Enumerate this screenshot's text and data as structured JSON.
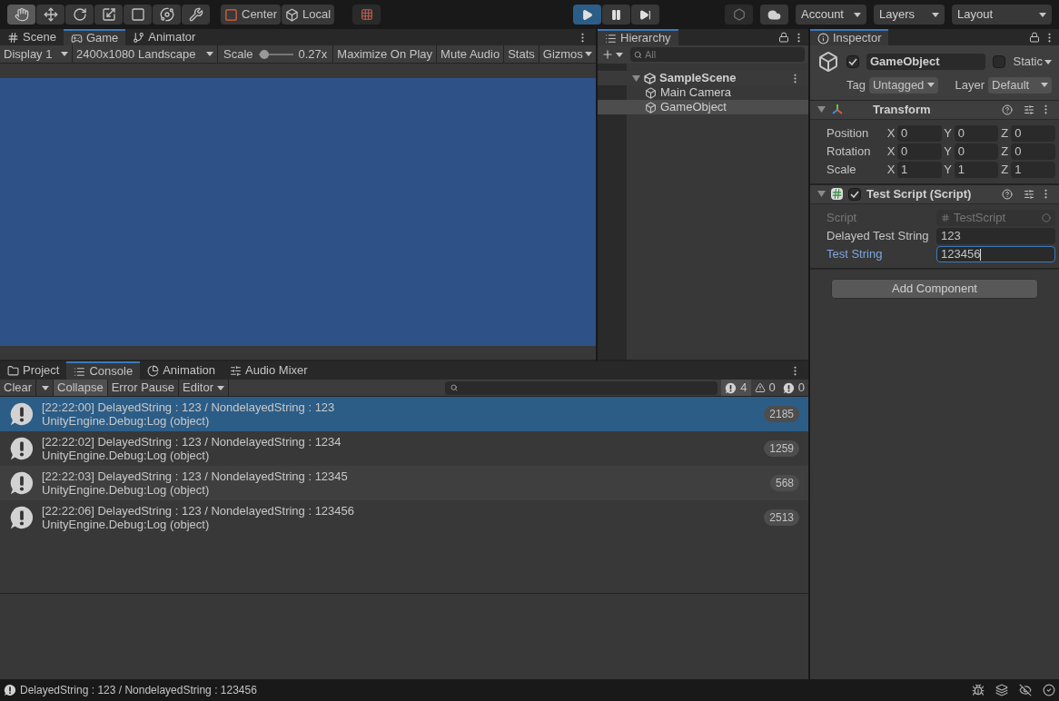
{
  "toolbar": {
    "tools": [
      {
        "kind": "hand",
        "selected": true
      },
      {
        "kind": "move",
        "selected": false
      },
      {
        "kind": "rotate",
        "selected": false
      },
      {
        "kind": "scale",
        "selected": false
      },
      {
        "kind": "rect",
        "selected": false
      },
      {
        "kind": "transform",
        "selected": false
      },
      {
        "kind": "custom",
        "selected": false
      }
    ],
    "pivot": [
      "Center",
      "Local"
    ],
    "playback": [
      {
        "kind": "play",
        "selected": true
      },
      {
        "kind": "pause",
        "selected": false
      },
      {
        "kind": "step",
        "selected": false
      }
    ],
    "menus": [
      "Account",
      "Layers",
      "Layout"
    ]
  },
  "scene_tabs": [
    {
      "label": "Scene",
      "kind": "scene",
      "selected": false
    },
    {
      "label": "Game",
      "kind": "game",
      "selected": true
    },
    {
      "label": "Animator",
      "kind": "animator",
      "selected": false
    }
  ],
  "game_toolbar": {
    "display": "Display 1",
    "resolution": "2400x1080 Landscape",
    "scale_label": "Scale",
    "scale": {
      "level": 0.05,
      "reading": "0.27x"
    },
    "toggles": [
      {
        "label": "Maximize On Play",
        "selected": false
      },
      {
        "label": "Mute Audio",
        "selected": false
      },
      {
        "label": "Stats",
        "selected": false
      }
    ],
    "gizmos": "Gizmos"
  },
  "hierarchy": {
    "tab": "Hierarchy",
    "search": {
      "placeholder": "All"
    },
    "tree": [
      {
        "label": "SampleScene",
        "kind": "scene",
        "expanded": true,
        "selected": false,
        "children": [
          {
            "label": "Main Camera",
            "kind": "object",
            "selected": false
          },
          {
            "label": "GameObject",
            "kind": "object",
            "selected": true
          }
        ]
      }
    ]
  },
  "inspector": {
    "tab": "Inspector",
    "object": {
      "active": true,
      "name": "GameObject",
      "static": false,
      "static_label": "Static",
      "tag_label": "Tag",
      "tag": "Untagged",
      "layer_label": "Layer",
      "layer": "Default"
    },
    "components": [
      {
        "kind": "transform",
        "title": "Transform",
        "expanded": true,
        "rows": [
          {
            "label": "Position",
            "values": [
              {
                "axis": "X",
                "value": "0"
              },
              {
                "axis": "Y",
                "value": "0"
              },
              {
                "axis": "Z",
                "value": "0"
              }
            ]
          },
          {
            "label": "Rotation",
            "values": [
              {
                "axis": "X",
                "value": "0"
              },
              {
                "axis": "Y",
                "value": "0"
              },
              {
                "axis": "Z",
                "value": "0"
              }
            ]
          },
          {
            "label": "Scale",
            "values": [
              {
                "axis": "X",
                "value": "1"
              },
              {
                "axis": "Y",
                "value": "1"
              },
              {
                "axis": "Z",
                "value": "1"
              }
            ]
          }
        ]
      },
      {
        "kind": "script",
        "title": "Test Script (Script)",
        "expanded": true,
        "enabled": true,
        "fields": [
          {
            "label": "Script",
            "kind": "object",
            "value": "TestScript",
            "disabled": true,
            "focused": false
          },
          {
            "label": "Delayed Test String",
            "kind": "text",
            "value": "123",
            "disabled": false,
            "focused": false
          },
          {
            "label": "Test String",
            "kind": "text",
            "value": "123456",
            "disabled": false,
            "focused": true
          }
        ]
      }
    ],
    "add_button": "Add Component"
  },
  "console": {
    "tabs": [
      {
        "label": "Project",
        "kind": "project",
        "selected": false
      },
      {
        "label": "Console",
        "kind": "console",
        "selected": true
      },
      {
        "label": "Animation",
        "kind": "animation",
        "selected": false
      },
      {
        "label": "Audio Mixer",
        "kind": "mixer",
        "selected": false
      }
    ],
    "buttons": [
      {
        "label": "Clear",
        "kind": "split",
        "selected": false
      },
      {
        "label": "Collapse",
        "kind": "toggle",
        "selected": true
      },
      {
        "label": "Error Pause",
        "kind": "toggle",
        "selected": false
      },
      {
        "label": "Editor",
        "kind": "dropdown",
        "selected": false
      }
    ],
    "counts": [
      {
        "kind": "info",
        "count": "4"
      },
      {
        "kind": "warning",
        "count": "0"
      },
      {
        "kind": "error",
        "count": "0"
      }
    ],
    "entries": [
      {
        "message": "[22:22:00] DelayedString : 123 / NondelayedString : 123",
        "source": "UnityEngine.Debug:Log (object)",
        "count": "2185",
        "selected": true
      },
      {
        "message": "[22:22:02] DelayedString : 123 / NondelayedString : 1234",
        "source": "UnityEngine.Debug:Log (object)",
        "count": "1259",
        "selected": false
      },
      {
        "message": "[22:22:03] DelayedString : 123 / NondelayedString : 12345",
        "source": "UnityEngine.Debug:Log (object)",
        "count": "568",
        "selected": false
      },
      {
        "message": "[22:22:06] DelayedString : 123 / NondelayedString : 123456",
        "source": "UnityEngine.Debug:Log (object)",
        "count": "2513",
        "selected": false
      }
    ]
  },
  "status_bar": {
    "message": "DelayedString : 123 / NondelayedString : 123456"
  }
}
